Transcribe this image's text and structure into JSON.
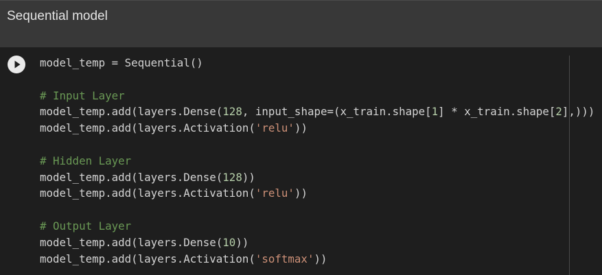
{
  "text_cell": {
    "heading": "Sequential model"
  },
  "code_cell": {
    "run_button": "run-cell",
    "lines": [
      [
        {
          "t": "model_temp = Sequential()",
          "c": "default"
        }
      ],
      [],
      [
        {
          "t": "# Input Layer",
          "c": "comment"
        }
      ],
      [
        {
          "t": "model_temp.add(layers.Dense(",
          "c": "default"
        },
        {
          "t": "128",
          "c": "number"
        },
        {
          "t": ", input_shape=(x_train.shape[",
          "c": "default"
        },
        {
          "t": "1",
          "c": "number"
        },
        {
          "t": "] * x_train.shape[",
          "c": "default"
        },
        {
          "t": "2",
          "c": "number"
        },
        {
          "t": "],)))",
          "c": "default"
        }
      ],
      [
        {
          "t": "model_temp.add(layers.Activation(",
          "c": "default"
        },
        {
          "t": "'relu'",
          "c": "string"
        },
        {
          "t": "))",
          "c": "default"
        }
      ],
      [],
      [
        {
          "t": "# Hidden Layer",
          "c": "comment"
        }
      ],
      [
        {
          "t": "model_temp.add(layers.Dense(",
          "c": "default"
        },
        {
          "t": "128",
          "c": "number"
        },
        {
          "t": "))",
          "c": "default"
        }
      ],
      [
        {
          "t": "model_temp.add(layers.Activation(",
          "c": "default"
        },
        {
          "t": "'relu'",
          "c": "string"
        },
        {
          "t": "))",
          "c": "default"
        }
      ],
      [],
      [
        {
          "t": "# Output Layer",
          "c": "comment"
        }
      ],
      [
        {
          "t": "model_temp.add(layers.Dense(",
          "c": "default"
        },
        {
          "t": "10",
          "c": "number"
        },
        {
          "t": "))",
          "c": "default"
        }
      ],
      [
        {
          "t": "model_temp.add(layers.Activation(",
          "c": "default"
        },
        {
          "t": "'softmax'",
          "c": "string"
        },
        {
          "t": "))",
          "c": "default"
        }
      ]
    ]
  },
  "colors": {
    "background": "#1e1e1e",
    "text_cell_background": "#383838",
    "comment": "#6a9955",
    "number": "#b5cea8",
    "string": "#ce9178",
    "default": "#d4d4d4"
  }
}
